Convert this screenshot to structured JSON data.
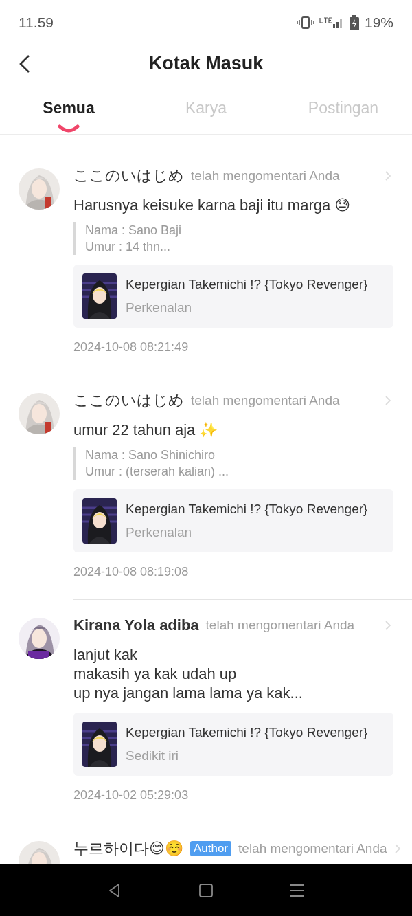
{
  "status_bar": {
    "time": "11.59",
    "battery": "19%"
  },
  "header": {
    "title": "Kotak Masuk"
  },
  "tabs": [
    {
      "label": "Semua",
      "selected": true
    },
    {
      "label": "Karya",
      "selected": false
    },
    {
      "label": "Postingan",
      "selected": false
    }
  ],
  "notifications": [
    {
      "kind": "comment",
      "name": "ここのいはじめ",
      "name_bold": false,
      "action": "telah mengomentari Anda",
      "message": "Harusnya keisuke karna baji itu marga 😓",
      "quote": [
        "Nama : Sano Baji",
        "Umur : 14 thn..."
      ],
      "work": {
        "title": "Kepergian Takemichi !? {Tokyo Revenger}",
        "chapter": "Perkenalan"
      },
      "timestamp": "2024-10-08 08:21:49"
    },
    {
      "kind": "comment",
      "name": "ここのいはじめ",
      "name_bold": false,
      "action": "telah mengomentari Anda",
      "message": "umur 22 tahun aja ✨",
      "quote": [
        "Nama : Sano Shinichiro",
        "Umur : (terserah kalian) ..."
      ],
      "work": {
        "title": "Kepergian Takemichi !? {Tokyo Revenger}",
        "chapter": "Perkenalan"
      },
      "timestamp": "2024-10-08 08:19:08"
    },
    {
      "kind": "comment",
      "name": "Kirana Yola adiba",
      "name_bold": true,
      "action": "telah mengomentari Anda",
      "message": "lanjut kak\nmakasih ya kak udah up\nup nya jangan lama lama ya kak...",
      "work": {
        "title": "Kepergian Takemichi !? {Tokyo Revenger}",
        "chapter": "Sedikit iri"
      },
      "timestamp": "2024-10-02 05:29:03"
    },
    {
      "kind": "comment",
      "name": "누르하이다😊☺️",
      "name_bold": false,
      "badge": "Author",
      "action": "telah mengomentari Anda"
    }
  ]
}
